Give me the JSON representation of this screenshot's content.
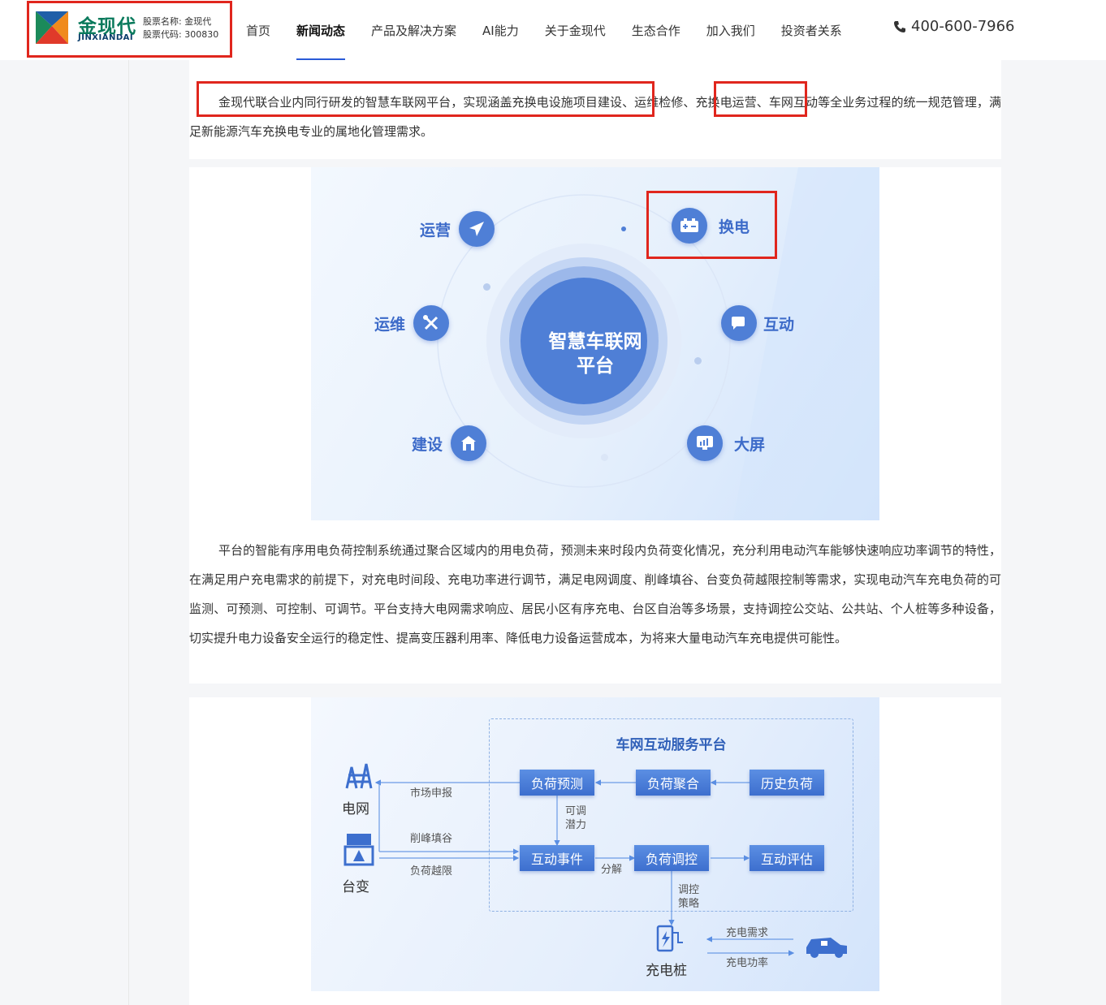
{
  "header": {
    "logo_cn": "金现代",
    "logo_en": "JINXIANDAI",
    "stock_name_label": "股票名称:",
    "stock_name": "金现代",
    "stock_code_label": "股票代码:",
    "stock_code": "300830",
    "phone": "400-600-7966"
  },
  "nav": [
    "首页",
    "新闻动态",
    "产品及解决方案",
    "AI能力",
    "关于金现代",
    "生态合作",
    "加入我们",
    "投资者关系"
  ],
  "nav_active_index": 1,
  "article": {
    "para1": "金现代联合业内同行研发的智慧车联网平台，实现涵盖充换电设施项目建设、运维检修、充换电运营、车网互动等全业务过程的统一规范管理，满足新能源汽车充换电专业的属地化管理需求。",
    "para2": "平台的智能有序用电负荷控制系统通过聚合区域内的用电负荷，预测未来时段内负荷变化情况，充分利用电动汽车能够快速响应功率调节的特性，在满足用户充电需求的前提下，对充电时间段、充电功率进行调节，满足电网调度、削峰填谷、台变负荷越限控制等需求，实现电动汽车充电负荷的可监测、可预测、可控制、可调节。平台支持大电网需求响应、居民小区有序充电、台区自治等多场景，支持调控公交站、公共站、个人桩等多种设备，切实提升电力设备安全运行的稳定性、提高变压器利用率、降低电力设备运营成本，为将来大量电动汽车充电提供可能性。"
  },
  "figure1": {
    "center": [
      "智慧车联网",
      "平台"
    ],
    "nodes": {
      "operate": "运营",
      "swap": "换电",
      "maintain": "运维",
      "interact": "互动",
      "build": "建设",
      "screen": "大屏"
    }
  },
  "figure2": {
    "title": "车网互动服务平台",
    "boxes": {
      "forecast": "负荷预测",
      "aggregate": "负荷聚合",
      "history": "历史负荷",
      "event": "互动事件",
      "control": "负荷调控",
      "evaluate": "互动评估"
    },
    "labels": {
      "grid": "电网",
      "transformer": "台变",
      "charger": "充电桩",
      "market": "市场申报",
      "peak": "削峰填谷",
      "overlimit": "负荷越限",
      "potential": [
        "可调",
        "潜力"
      ],
      "decompose": "分解",
      "strategy": [
        "调控",
        "策略"
      ],
      "demand": "充电需求",
      "power": "充电功率"
    }
  },
  "colors": {
    "highlight": "#e0261d",
    "brand_green": "#0a7a5c",
    "accent_blue": "#2a5bd7",
    "node_blue": "#4f7fd6"
  }
}
